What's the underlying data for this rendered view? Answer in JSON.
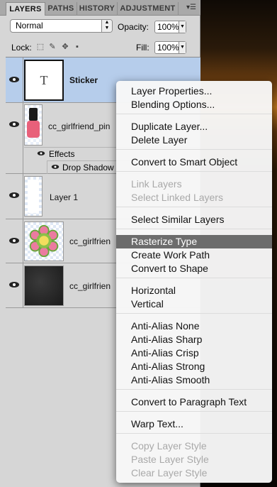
{
  "panel": {
    "tabs": [
      "LAYERS",
      "PATHS",
      "HISTORY",
      "ADJUSTMENT"
    ],
    "menu_icon": "panel-menu-icon",
    "blend_mode": "Normal",
    "opacity_label": "Opacity:",
    "opacity_value": "100%",
    "lock_label": "Lock:",
    "fill_label": "Fill:",
    "fill_value": "100%"
  },
  "layers": [
    {
      "name": "Sticker",
      "type": "text",
      "thumb_glyph": "T",
      "selected": true
    },
    {
      "name": "cc_girlfriend_pin",
      "type": "image",
      "effects_label": "Effects",
      "effect": "Drop Shadow"
    },
    {
      "name": "Layer 1",
      "type": "image"
    },
    {
      "name": "cc_girlfrien",
      "type": "flower"
    },
    {
      "name": "cc_girlfrien",
      "type": "dark"
    }
  ],
  "context_menu": {
    "groups": [
      [
        {
          "label": "Layer Properties...",
          "enabled": true
        },
        {
          "label": "Blending Options...",
          "enabled": true
        }
      ],
      [
        {
          "label": "Duplicate Layer...",
          "enabled": true
        },
        {
          "label": "Delete Layer",
          "enabled": true
        }
      ],
      [
        {
          "label": "Convert to Smart Object",
          "enabled": true
        }
      ],
      [
        {
          "label": "Link Layers",
          "enabled": false
        },
        {
          "label": "Select Linked Layers",
          "enabled": false
        }
      ],
      [
        {
          "label": "Select Similar Layers",
          "enabled": true
        }
      ],
      [
        {
          "label": "Rasterize Type",
          "enabled": true,
          "highlighted": true
        },
        {
          "label": "Create Work Path",
          "enabled": true
        },
        {
          "label": "Convert to Shape",
          "enabled": true
        }
      ],
      [
        {
          "label": "Horizontal",
          "enabled": true
        },
        {
          "label": "Vertical",
          "enabled": true
        }
      ],
      [
        {
          "label": "Anti-Alias None",
          "enabled": true
        },
        {
          "label": "Anti-Alias Sharp",
          "enabled": true
        },
        {
          "label": "Anti-Alias Crisp",
          "enabled": true
        },
        {
          "label": "Anti-Alias Strong",
          "enabled": true
        },
        {
          "label": "Anti-Alias Smooth",
          "enabled": true
        }
      ],
      [
        {
          "label": "Convert to Paragraph Text",
          "enabled": true
        }
      ],
      [
        {
          "label": "Warp Text...",
          "enabled": true
        }
      ],
      [
        {
          "label": "Copy Layer Style",
          "enabled": false
        },
        {
          "label": "Paste Layer Style",
          "enabled": false
        },
        {
          "label": "Clear Layer Style",
          "enabled": false
        }
      ]
    ]
  }
}
